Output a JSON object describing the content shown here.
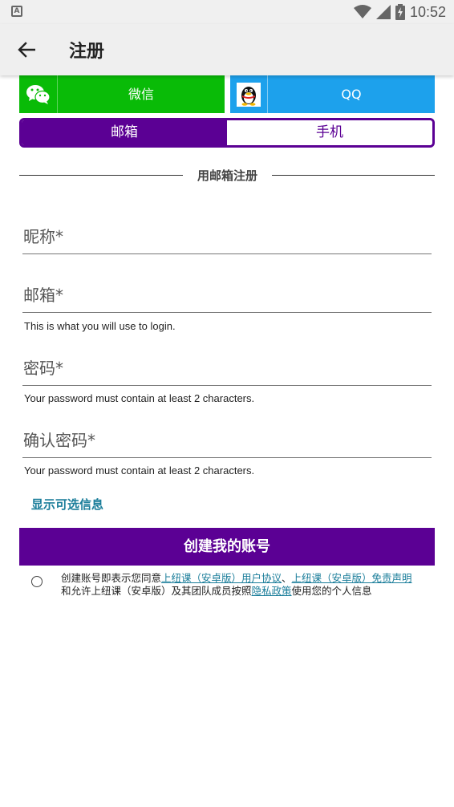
{
  "status_bar": {
    "time": "10:52",
    "notification_icon": "a-icon",
    "wifi_icon": "wifi-icon",
    "signal_icon": "signal-icon",
    "battery_icon": "battery-charging-icon"
  },
  "app_bar": {
    "title": "注册",
    "back_icon": "arrow-back-icon"
  },
  "social": {
    "wechat_label": "微信",
    "qq_label": "QQ"
  },
  "segment": {
    "email_label": "邮箱",
    "phone_label": "手机"
  },
  "section_heading": "用邮箱注册",
  "fields": {
    "nickname_label": "昵称*",
    "email_label": "邮箱*",
    "email_help": "This is what you will use to login.",
    "password_label": "密码*",
    "password_help": "Your password must contain at least 2 characters.",
    "confirm_label": "确认密码*",
    "confirm_help": "Your password must contain at least 2 characters."
  },
  "optional_link": "显示可选信息",
  "create_button": "创建我的账号",
  "agreement": {
    "prefix": "创建账号即表示您同意",
    "user_agreement": "上纽课（安卓版）用户协议",
    "sep": "、",
    "disclaimer": "上纽课（安卓版）免责声明",
    "middle": "和允许上纽课（安卓版）及其团队成员按照",
    "privacy": "隐私政策",
    "suffix": "使用您的个人信息"
  },
  "colors": {
    "primary": "#5b0094",
    "wechat": "#09bb07",
    "qq": "#1da1ec",
    "link": "#1a7d9a"
  }
}
